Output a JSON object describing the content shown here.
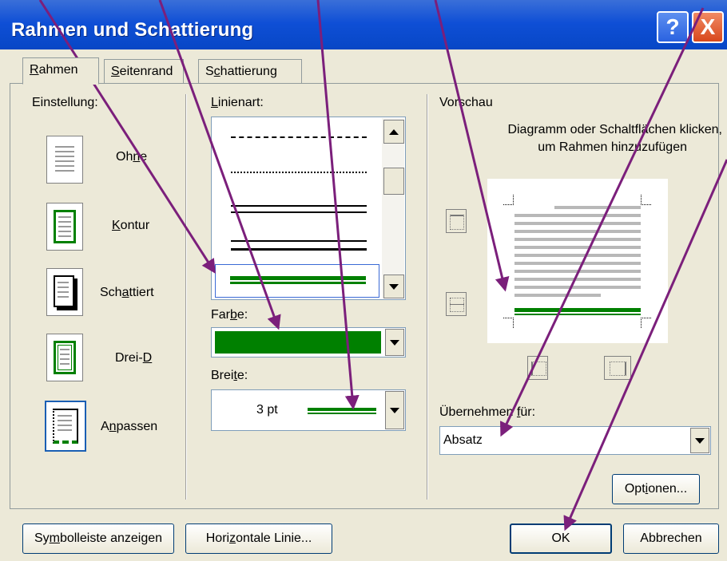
{
  "window": {
    "title": "Rahmen und Schattierung",
    "help_glyph": "?",
    "close_glyph": "X"
  },
  "tabs": [
    {
      "pre": "",
      "ul": "R",
      "post": "ahmen",
      "selected": true
    },
    {
      "pre": "",
      "ul": "S",
      "post": "eitenrand",
      "selected": false
    },
    {
      "pre": "S",
      "ul": "c",
      "post": "hattierung",
      "selected": false
    }
  ],
  "einstellung": {
    "label": "Einstellung:",
    "items": [
      {
        "pre": "Oh",
        "ul": "n",
        "post": "e",
        "icon": "none-border-icon"
      },
      {
        "pre": "",
        "ul": "K",
        "post": "ontur",
        "icon": "box-border-icon"
      },
      {
        "pre": "Sch",
        "ul": "a",
        "post": "ttiert",
        "icon": "shadow-border-icon"
      },
      {
        "pre": "Drei-",
        "ul": "D",
        "post": "",
        "icon": "3d-border-icon"
      },
      {
        "pre": "A",
        "ul": "n",
        "post": "passen",
        "icon": "custom-border-icon"
      }
    ]
  },
  "linienart": {
    "pre": "",
    "ul": "L",
    "post": "inienart:"
  },
  "farbe": {
    "pre": "Far",
    "ul": "b",
    "post": "e:",
    "value_color": "#008000"
  },
  "breite": {
    "pre": "Brei",
    "ul": "t",
    "post": "e:",
    "value": "3 pt"
  },
  "vorschau": {
    "label": "Vorschau",
    "hint_line1": "Diagramm oder Schaltflächen klicken,",
    "hint_line2": "um Rahmen hinzuzufügen"
  },
  "uebernehmen": {
    "pre": "Übernehmen ",
    "ul": "f",
    "post": "ür:",
    "value": "Absatz"
  },
  "buttons": {
    "optionen": {
      "pre": "Opt",
      "ul": "i",
      "post": "onen..."
    },
    "symbolleiste": {
      "pre": "Sy",
      "ul": "m",
      "post": "bolleiste anzeigen"
    },
    "horizontale": {
      "pre": "Hori",
      "ul": "z",
      "post": "ontale Linie..."
    },
    "ok": "OK",
    "abbrechen": "Abbrechen"
  },
  "colors": {
    "accent_green": "#008000",
    "annotation_arrow": "#7b1f7b",
    "titlebar": "#0a48c8"
  }
}
